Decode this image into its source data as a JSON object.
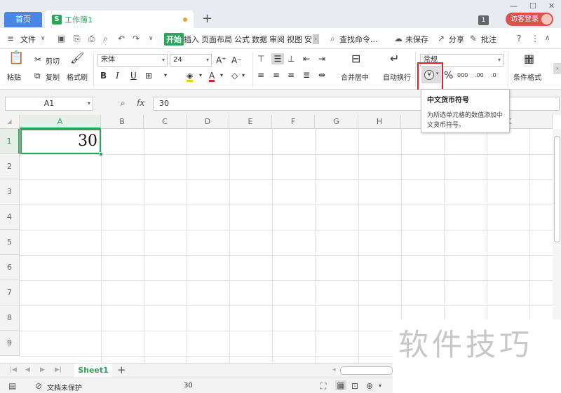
{
  "titlebar": {
    "home_tab": "首页",
    "doc_tab": "工作簿1",
    "badge": "1",
    "login": "访客登录"
  },
  "menubar": {
    "file": "文件",
    "tabs": [
      "开始",
      "插入",
      "页面布局",
      "公式",
      "数据",
      "审阅",
      "视图",
      "安"
    ],
    "search": "查找命令...",
    "unsaved": "未保存",
    "share": "分享",
    "comment": "批注"
  },
  "ribbon": {
    "paste": "粘贴",
    "cut": "剪切",
    "copy": "复制",
    "format_painter": "格式刷",
    "font_name": "宋体",
    "font_size": "24",
    "merge_center": "合并居中",
    "wrap_text": "自动换行",
    "number_format": "常规",
    "percent": "%",
    "thousands": "000",
    "inc_decimal": ".00",
    "dec_decimal": ".0",
    "cond_format": "条件格式"
  },
  "tooltip": {
    "title": "中文货币符号",
    "desc": "为所选单元格的数值添加中文货币符号。"
  },
  "formula_bar": {
    "cell_ref": "A1",
    "fx": "fx",
    "value": "30"
  },
  "grid": {
    "columns": [
      "A",
      "B",
      "C",
      "D",
      "E",
      "F",
      "G",
      "H",
      "I",
      "J",
      "K"
    ],
    "rows": [
      "1",
      "2",
      "3",
      "4",
      "5",
      "6",
      "7",
      "8",
      "9"
    ],
    "cell_A1": "30"
  },
  "sheet_bar": {
    "sheet_name": "Sheet1",
    "add": "+"
  },
  "status_bar": {
    "protect": "文档未保护",
    "sum": "30"
  },
  "watermark": "软件技巧",
  "colors": {
    "accent_green": "#2ba55a",
    "highlight_red": "#e0202a",
    "login_red": "#d9534f",
    "home_blue": "#4a86e8"
  }
}
